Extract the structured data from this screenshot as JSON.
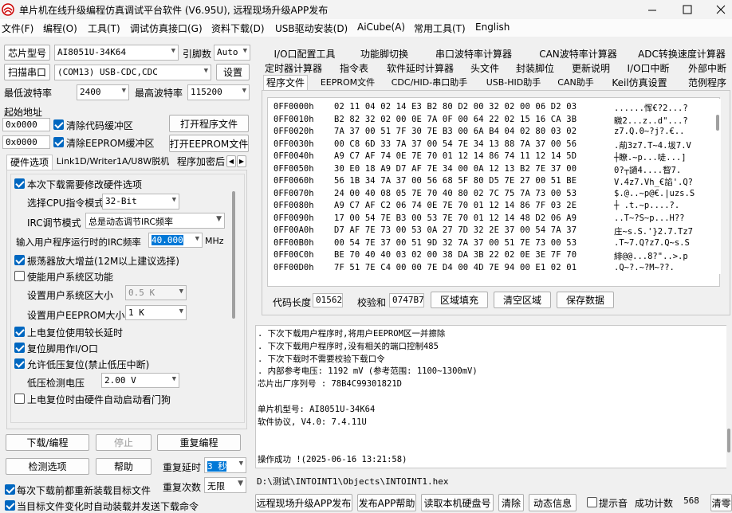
{
  "title": "单片机在线升级编程仿真调试平台软件 (V6.95U), 远程现场升级APP发布",
  "menu": [
    "文件(F)",
    "编程(O)",
    "工具(T)",
    "调试仿真接口(G)",
    "资料下载(D)",
    "USB驱动安装(D)",
    "AiCube(A)",
    "常用工具(T)",
    "English"
  ],
  "left": {
    "mcu_label": "芯片型号",
    "mcu_value": "AI8051U-34K64",
    "pin_label": "引脚数",
    "pin_value": "Auto",
    "scan_button": "扫描串口",
    "port_value": "(COM13) USB-CDC,CDC",
    "settings_button": "设置",
    "min_baud_label": "最低波特率",
    "min_baud_value": "2400",
    "max_baud_label": "最高波特率",
    "max_baud_value": "115200",
    "start_addr_label": "起始地址",
    "addr1": "0x0000",
    "clear_code": "清除代码缓冲区",
    "open_prog": "打开程序文件",
    "addr2": "0x0000",
    "clear_eeprom": "清除EEPROM缓冲区",
    "open_eeprom": "打开EEPROM文件",
    "tabs": [
      "硬件选项",
      "Link1D/Writer1A/U8W脱机",
      "程序加密后"
    ],
    "opts": {
      "opt1": "本次下载需要修改硬件选项",
      "cpu_label": "选择CPU指令模式",
      "cpu_value": "32-Bit",
      "irc_label": "IRC调节模式",
      "irc_value": "总是动态调节IRC频率",
      "freq_label": "输入用户程序运行时的IRC频率",
      "freq_value": "40.000",
      "freq_unit": "MHz",
      "opt2": "振荡器放大增益(12M以上建议选择)",
      "opt3": "使能用户系统区功能",
      "sys_size_label": "设置用户系统区大小",
      "sys_size_value": "0.5 K",
      "ee_size_label": "设置用户EEPROM大小",
      "ee_size_value": "1   K",
      "opt4": "上电复位使用较长延时",
      "opt5": "复位脚用作I/O口",
      "opt6": "允许低压复位(禁止低压中断)",
      "lv_label": "低压检测电压",
      "lv_value": "2.00 V",
      "opt7": "上电复位时由硬件自动启动看门狗"
    },
    "download_button": "下载/编程",
    "stop_button": "停止",
    "reprogram_button": "重复编程",
    "check_button": "检测选项",
    "help_button": "帮助",
    "delay_label": "重复延时",
    "delay_value": "3 秒",
    "repeat_label": "重复次数",
    "repeat_value": "无限",
    "reload_cb": "每次下载前都重新装载目标文件",
    "auto_cb": "当目标文件变化时自动装载并发送下载命令"
  },
  "right_tabs": {
    "row1": [
      "I/O口配置工具",
      "功能脚切换",
      "串口波特率计算器",
      "CAN波特率计算器",
      "ADC转换速度计算器"
    ],
    "row2": [
      "定时器计算器",
      "指令表",
      "软件延时计算器",
      "头文件",
      "封装脚位",
      "更新说明",
      "I/O口中断",
      "外部中断"
    ],
    "row3": [
      "程序文件",
      "EEPROM文件",
      "CDC/HID-串口助手",
      "USB-HID助手",
      "CAN助手",
      "Keil仿真设置",
      "范例程序"
    ]
  },
  "hex": [
    {
      "addr": "0FF0000h",
      "bytes": "02 11 04 02 14 E3 B2 80 D2 00 32 02 00 06 D2 03",
      "ascii": "......恽€?2...?"
    },
    {
      "addr": "0FF0010h",
      "bytes": "B2 82 32 02 00 0E 7A 0F 00 64 22 02 15 16 CA 3B",
      "ascii": "矀2...z..d\"...?"
    },
    {
      "addr": "0FF0020h",
      "bytes": "7A 37 00 51 7F 30 7E B3 00 6A B4 04 02 80 03 02",
      "ascii": "z7.Q.0~?j?.€.."
    },
    {
      "addr": "0FF0030h",
      "bytes": "00 C8 6D 33 7A 37 00 54 7E 34 13 88 7A 37 00 56",
      "ascii": ".萷3z7.T~4.坺7.V"
    },
    {
      "addr": "0FF0040h",
      "bytes": "A9 C7 AF 74 0E 7E 70 01 12 14 86 74 11 12 14 5D",
      "ascii": "┼瞭.~p...唗...]"
    },
    {
      "addr": "0FF0050h",
      "bytes": "30 E0 18 A9 D7 AF 7E 34 00 0A 12 13 B2 7E 37 00",
      "ascii": "0?┬讁4....睝7."
    },
    {
      "addr": "0FF0060h",
      "bytes": "56 1B 34 7A 37 00 56 68 5F 80 D5 7E 27 00 51 BE",
      "ascii": "V.4z7.Vh_€諂'.Q?"
    },
    {
      "addr": "0FF0070h",
      "bytes": "24 00 40 08 05 7E 70 40 80 02 7C 75 7A 73 00 53",
      "ascii": "$.@..~p@€.|uzs.S"
    },
    {
      "addr": "0FF0080h",
      "bytes": "A9 C7 AF C2 06 74 0E 7E 70 01 12 14 86 7F 03 2E",
      "ascii": "┼  .t.~p....?."
    },
    {
      "addr": "0FF0090h",
      "bytes": "17 00 54 7E B3 00 53 7E 70 01 12 14 48 D2 06 A9",
      "ascii": "..T~?S~p...H??"
    },
    {
      "addr": "0FF00A0h",
      "bytes": "D7 AF 7E 73 00 53 0A 27 7D 32 2E 37 00 54 7A 37",
      "ascii": "庄~s.S.'}2.7.Tz7"
    },
    {
      "addr": "0FF00B0h",
      "bytes": "00 54 7E 37 00 51 9D 32 7A 37 00 51 7E 73 00 53",
      "ascii": ".T~7.Q?z7.Q~s.S"
    },
    {
      "addr": "0FF00C0h",
      "bytes": "BE 70 40 40 03 02 00 38 DA 3B 22 02 0E 3E 7F 70",
      "ascii": "緋@@...8?\"..>.p"
    },
    {
      "addr": "0FF00D0h",
      "bytes": "7F 51 7E C4 00 00 7E D4 00 4D 7E 94 00 E1 02 01",
      "ascii": ".Q~?.~?M~??."
    }
  ],
  "code_len_label": "代码长度",
  "code_len_value": "01562",
  "checksum_label": "校验和",
  "checksum_value": "0747B7",
  "fill_button": "区域填充",
  "clear_button": "清空区域",
  "save_button": "保存数据",
  "log": [
    ". 下次下载用户程序时,将用户EEPROM区一并擦除",
    ". 下次下载用户程序时,没有相关的端口控制485",
    ". 下次下载时不需要校验下载口令",
    ". 内部参考电压: 1192 mV (参考范围: 1100~1300mV)",
    "芯片出厂序列号 : 78B4C99301821D",
    "",
    "  单片机型号: AI8051U-34K64",
    "  软件协议, V4.0: 7.4.11U",
    "",
    "",
    "操作成功 !(2025-06-16 13:21:58)"
  ],
  "file_path": "D:\\测试\\INTOINT1\\Objects\\INTOINT1.hex",
  "bottom": {
    "publish": "远程现场升级APP发布",
    "publish_help": "发布APP帮助",
    "read_disk": "读取本机硬盘号",
    "clear": "清除",
    "anim": "动态信息",
    "beep": "提示音",
    "count_label": "成功计数",
    "count_value": "568",
    "clear2": "清零"
  }
}
